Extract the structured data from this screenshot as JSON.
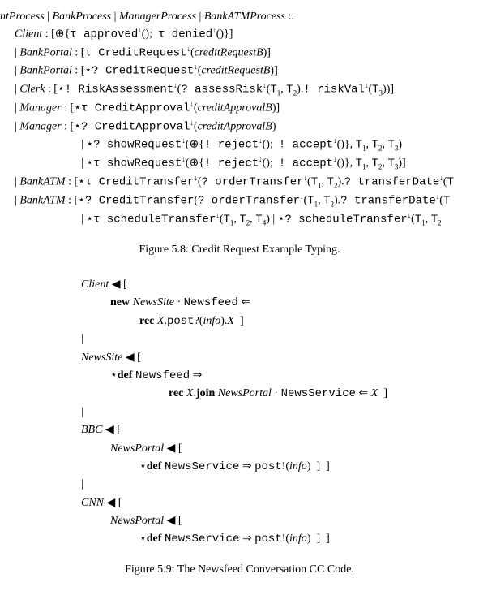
{
  "fig58": {
    "l1_a": "ntProcess",
    "l1_b": "BankProcess",
    "l1_c": "ManagerProcess",
    "l1_d": "BankATMProcess",
    "l2_role": "Client",
    "l2_t1": "τ approved",
    "l2_t2": "τ denied",
    "l3_role": "BankPortal",
    "l3_t": "τ CreditRequest",
    "l3_arg": "creditRequestB",
    "l4_role": "BankPortal",
    "l4_t": "⋆? CreditRequest",
    "l4_arg": "creditRequestB",
    "l5_role": "Clerk",
    "l5_t1": "⋆! RiskAssessment",
    "l5_t2": "? assessRisk",
    "l5_t3": "! riskVal",
    "l6_role": "Manager",
    "l6_t": "⋆τ CreditApproval",
    "l6_arg": "creditApprovalB",
    "l7_role": "Manager",
    "l7_t": "⋆? CreditApproval",
    "l7_arg": "creditApprovalB",
    "l8_t1": "⋆? showRequest",
    "l8_t2": "! reject",
    "l8_t3": "! accept",
    "l9_t1": "⋆τ showRequest",
    "l9_t2": "! reject",
    "l9_t3": "! accept",
    "l10_role": "BankATM",
    "l10_t1": "⋆τ CreditTransfer",
    "l10_t2": "? orderTransfer",
    "l10_t3": "? transferDate",
    "l11_role": "BankATM",
    "l11_t1": "⋆? CreditTransfer",
    "l11_t2": "? orderTransfer",
    "l11_t3": "? transferDate",
    "l12_t1": "⋆τ scheduleTransfer",
    "l12_t2": "⋆? scheduleTransfer",
    "caption": "Figure 5.8: Credit Request Example Typing."
  },
  "fig59": {
    "client": "Client",
    "new": "new",
    "newssite": "NewsSite",
    "newsfeed": "Newsfeed",
    "rec": "rec",
    "X": "X",
    "post": "post",
    "info": "info",
    "def": "def",
    "join": "join",
    "newsportal": "NewsPortal",
    "newsservice": "NewsService",
    "bbc": "BBC",
    "cnn": "CNN",
    "caption": "Figure 5.9: The Newsfeed Conversation CC Code."
  }
}
